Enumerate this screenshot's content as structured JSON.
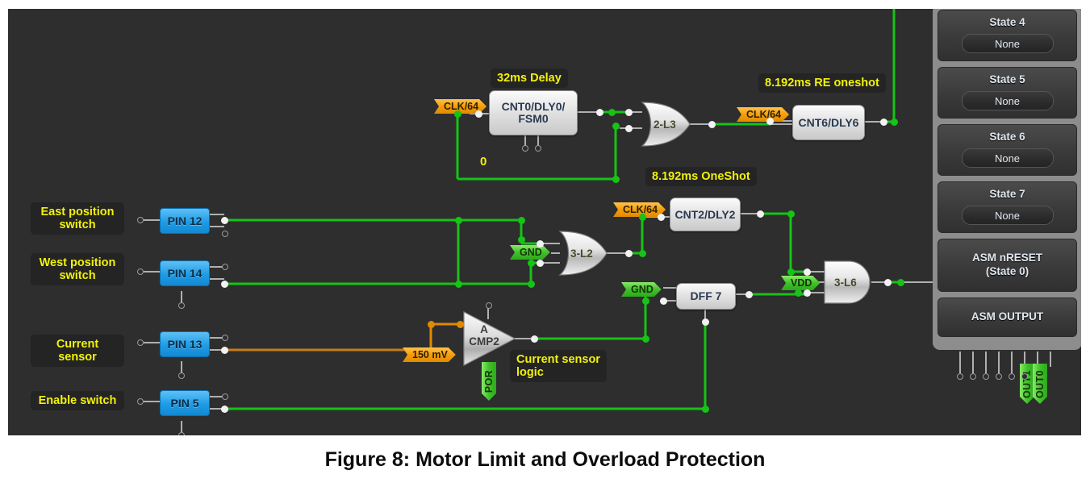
{
  "figure": {
    "caption": "Figure 8: Motor Limit and Overload Protection"
  },
  "colors": {
    "canvas_bg": "#2e2e2e",
    "wire_green": "#16c316",
    "wire_gray": "#b0b0b0",
    "wire_orange": "#e08a00",
    "label_yellow": "#f2f20a",
    "pin_blue": "#1e9ce6",
    "tag_orange": "#f59d0b",
    "tag_green": "#3fc22a",
    "panel_gray": "#8d8d8d"
  },
  "annotations": [
    {
      "id": "ann-32ms",
      "text": "32ms Delay"
    },
    {
      "id": "ann-re-oneshot",
      "text": "8.192ms RE oneshot"
    },
    {
      "id": "ann-oneshot",
      "text": "8.192ms OneShot"
    },
    {
      "id": "ann-zero",
      "text": "0"
    },
    {
      "id": "ann-current-sensor-logic",
      "text": "Current sensor\nlogic"
    }
  ],
  "pins": [
    {
      "id": "pin-12",
      "label": "PIN 12",
      "description": "East position\nswitch"
    },
    {
      "id": "pin-14",
      "label": "PIN 14",
      "description": "West position\nswitch"
    },
    {
      "id": "pin-13",
      "label": "PIN 13",
      "description": "Current sensor"
    },
    {
      "id": "pin-5",
      "label": "PIN 5",
      "description": "Enable switch"
    }
  ],
  "blocks": [
    {
      "id": "cnt0",
      "label": "CNT0/DLY0/\nFSM0"
    },
    {
      "id": "cnt6",
      "label": "CNT6/DLY6"
    },
    {
      "id": "cnt2",
      "label": "CNT2/DLY2"
    },
    {
      "id": "dff7",
      "label": "DFF 7"
    }
  ],
  "gates": [
    {
      "id": "gate-2l3",
      "label": "2-L3",
      "type": "or"
    },
    {
      "id": "gate-3l2",
      "label": "3-L2",
      "type": "or"
    },
    {
      "id": "gate-3l6",
      "label": "3-L6",
      "type": "and"
    }
  ],
  "comparator": {
    "id": "cmp2",
    "line1": "A",
    "line2": "CMP2",
    "threshold_tag": "150 mV",
    "por_tag": "POR"
  },
  "tags": [
    {
      "id": "tag-clk64-1",
      "text": "CLK/64",
      "kind": "orange"
    },
    {
      "id": "tag-clk64-2",
      "text": "CLK/64",
      "kind": "orange"
    },
    {
      "id": "tag-clk64-3",
      "text": "CLK/64",
      "kind": "orange"
    },
    {
      "id": "tag-gnd-1",
      "text": "GND",
      "kind": "green"
    },
    {
      "id": "tag-gnd-2",
      "text": "GND",
      "kind": "green"
    },
    {
      "id": "tag-vdd",
      "text": "VDD",
      "kind": "green"
    },
    {
      "id": "tag-out1",
      "text": "OUT1",
      "kind": "green-vertical"
    },
    {
      "id": "tag-out0",
      "text": "OUT0",
      "kind": "green-vertical"
    }
  ],
  "asm_panel": {
    "states": [
      {
        "id": "state-4",
        "name": "State 4",
        "value": "None"
      },
      {
        "id": "state-5",
        "name": "State 5",
        "value": "None"
      },
      {
        "id": "state-6",
        "name": "State 6",
        "value": "None"
      },
      {
        "id": "state-7",
        "name": "State 7",
        "value": "None"
      }
    ],
    "nreset": "ASM nRESET\n(State 0)",
    "output": "ASM OUTPUT"
  }
}
